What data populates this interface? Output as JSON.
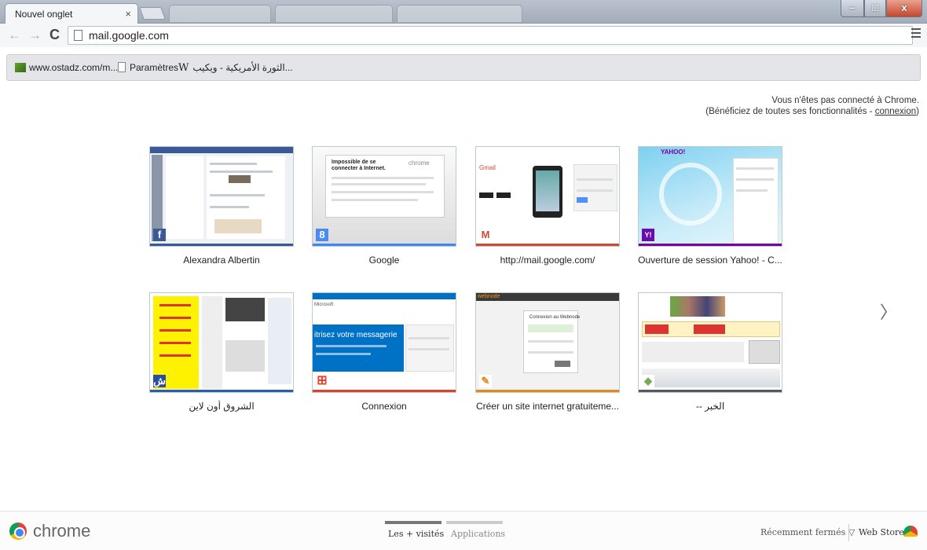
{
  "tab": {
    "title": "Nouvel onglet",
    "close": "×"
  },
  "toolbar": {
    "url": "mail.google.com",
    "back": "←",
    "forward": "→",
    "reload": "C"
  },
  "window_controls": {
    "close": "x"
  },
  "bookmarks": [
    {
      "label": "www.ostadz.com/m...",
      "icon": "site-icon"
    },
    {
      "label": "Paramètres",
      "icon": "page-icon"
    },
    {
      "label": "الثورة الأمريكية - ويكيب...",
      "icon": "wikipedia-icon",
      "icon_text": "W"
    }
  ],
  "signin": {
    "line1": "Vous n'êtes pas connecté à Chrome.",
    "line2_prefix": "(Bénéficiez de toutes ses fonctionnalités - ",
    "link": "connexion",
    "line2_suffix": ")"
  },
  "tiles": [
    {
      "title": "Alexandra Albertin",
      "accent": "#3b5998",
      "favicon": "f",
      "fav_bg": "#3b5998"
    },
    {
      "title": "Google",
      "accent": "#4285f4",
      "favicon": "8",
      "fav_bg": "#4a8af4"
    },
    {
      "title": "http://mail.google.com/",
      "accent": "#d14836",
      "favicon": "M",
      "fav_bg": "#ffffff"
    },
    {
      "title": "Ouverture de session Yahoo! - C...",
      "accent": "#7b0099",
      "favicon": "Y!",
      "fav_bg": "#6b0ab3"
    },
    {
      "title": "الشروق أون لاين",
      "accent": "#2a5db0",
      "favicon": "ش",
      "fav_bg": "#2a4fa0"
    },
    {
      "title": "Connexion",
      "accent": "#d9442a",
      "favicon": "⊞",
      "fav_bg": "#ffffff"
    },
    {
      "title": "Créer un site internet gratuiteme...",
      "accent": "#e08a1e",
      "favicon": "✎",
      "fav_bg": "#ffffff"
    },
    {
      "title": "-- الخبر",
      "accent": "#555a62",
      "favicon": "◆",
      "fav_bg": "#ffffff"
    }
  ],
  "thumb_text": {
    "google_error_title": "Impossible de se connecter à Internet.",
    "google_error_brand": "chrome",
    "yahoo_brand": "YAHOO!",
    "ms_headline": "itrisez votre messagerie",
    "ms_brand": "Microsoft",
    "gmail_brand": "Gmail",
    "webnode_brand": "webnode",
    "webnode_form": "Connexion au Webnode"
  },
  "next_arrow": "〉",
  "bottom": {
    "brand": "chrome",
    "tab_most_visited": "Les + visités",
    "tab_apps": "Applications",
    "recently_closed": "Récemment fermés ▽",
    "web_store": "Web Store"
  },
  "colors": {
    "chrome_red": "#db4437",
    "chrome_yellow": "#f4b400",
    "chrome_green": "#0f9d58",
    "chrome_blue": "#4285f4"
  }
}
